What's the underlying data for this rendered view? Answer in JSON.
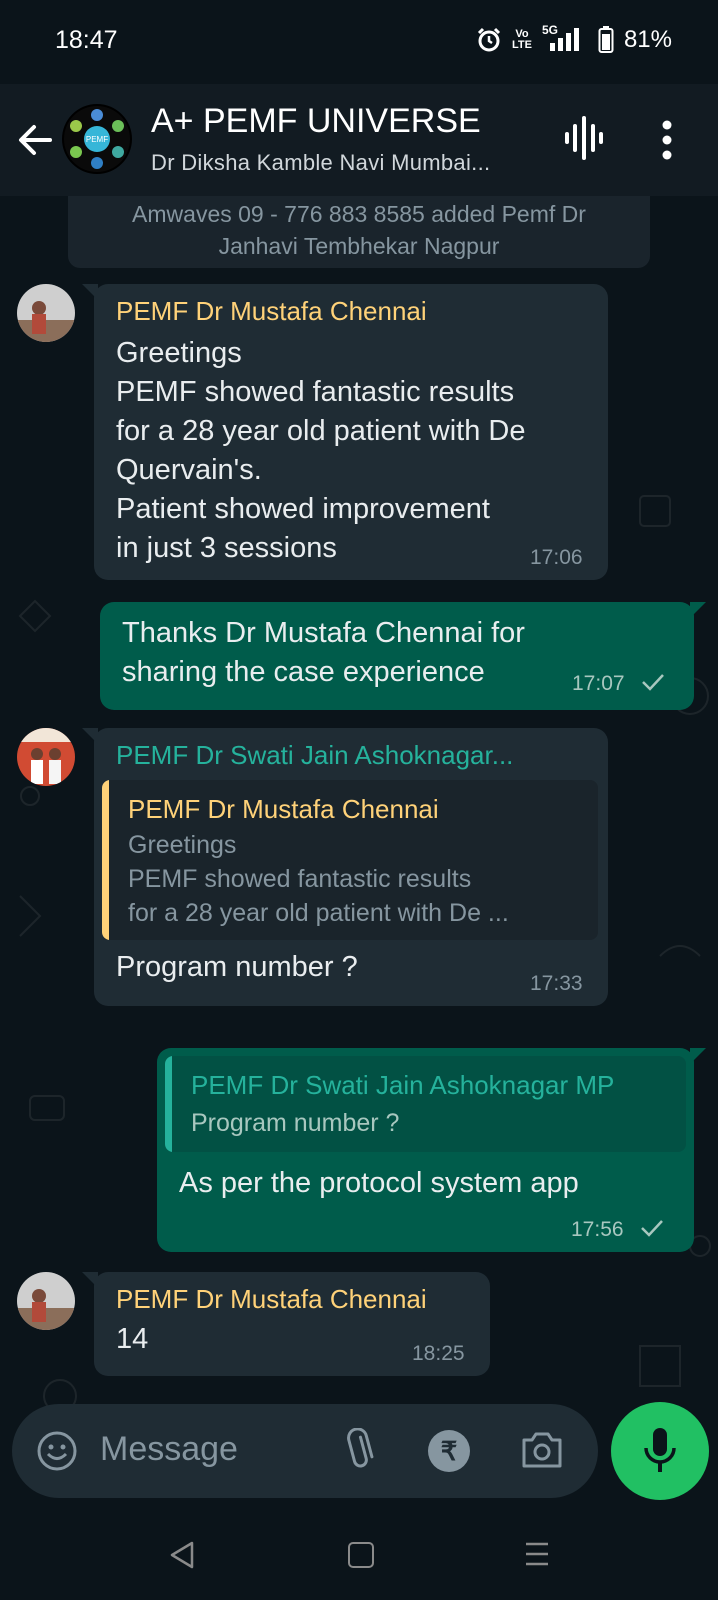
{
  "status_bar": {
    "time": "18:47",
    "volte_top": "Vo",
    "volte_bottom": "LTE",
    "network": "5G",
    "battery": "81%"
  },
  "header": {
    "title": "A+ PEMF UNIVERSE",
    "subtitle": "Dr Diksha Kamble Navi Mumbai...",
    "avatar_text": "PEMF",
    "icons": [
      "back-arrow-icon",
      "voice-wave-icon",
      "more-vert-icon"
    ]
  },
  "system_message": {
    "line1": "Amwaves 09 - 776 883 8585 added Pemf Dr",
    "line2": "Janhavi Tembhekar Nagpur"
  },
  "messages": [
    {
      "sender": "PEMF Dr Mustafa Chennai",
      "sender_color": "#ffd279",
      "lines": [
        "Greetings",
        "PEMF showed fantastic results",
        "for a 28 year old patient with De",
        "Quervain's.",
        "Patient showed improvement",
        "in just 3 sessions"
      ],
      "time": "17:06"
    },
    {
      "lines": [
        "Thanks Dr Mustafa Chennai for",
        "sharing the case experience"
      ],
      "time": "17:07",
      "status": "sent"
    },
    {
      "sender": "PEMF Dr Swati Jain Ashoknagar...",
      "sender_color": "#25b29c",
      "quote": {
        "sender": "PEMF Dr Mustafa Chennai",
        "color": "#ffd279",
        "lines": [
          "Greetings",
          "PEMF showed fantastic results",
          "for a 28 year old patient with De ..."
        ]
      },
      "text": "Program number ?",
      "time": "17:33"
    },
    {
      "quote": {
        "sender": "PEMF Dr Swati Jain Ashoknagar MP",
        "color": "#25b29c",
        "text": "Program number ?"
      },
      "text": "As per the protocol system app",
      "time": "17:56",
      "status": "sent"
    },
    {
      "sender": "PEMF Dr Mustafa Chennai",
      "sender_color": "#ffd279",
      "text": "14",
      "time": "18:25"
    }
  ],
  "composer": {
    "placeholder": "Message",
    "rupee_symbol": "₹"
  },
  "colors": {
    "incoming": "#1f2c34",
    "outgoing": "#005c4b",
    "accent": "#21c063",
    "background": "#0b141a"
  }
}
